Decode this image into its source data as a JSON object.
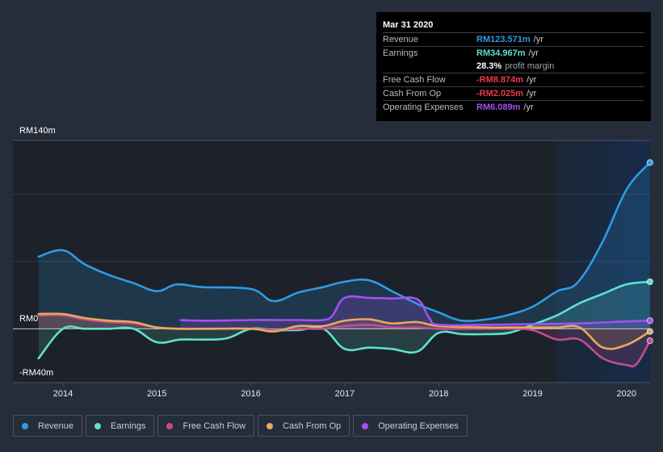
{
  "tooltip": {
    "date": "Mar 31 2020",
    "rows": [
      {
        "label": "Revenue",
        "value": "RM123.571m",
        "unit": "/yr",
        "color": "#2e9be6"
      },
      {
        "label": "Earnings",
        "value": "RM34.967m",
        "unit": "/yr",
        "color": "#5fe0cf"
      },
      {
        "label": "",
        "value": "28.3%",
        "unit": "profit margin",
        "color": "#ffffff"
      },
      {
        "label": "Free Cash Flow",
        "value": "-RM8.874m",
        "unit": "/yr",
        "color": "#ee3a46"
      },
      {
        "label": "Cash From Op",
        "value": "-RM2.025m",
        "unit": "/yr",
        "color": "#ee3a46"
      },
      {
        "label": "Operating Expenses",
        "value": "RM6.089m",
        "unit": "/yr",
        "color": "#a64ff2"
      }
    ]
  },
  "legend": [
    {
      "label": "Revenue",
      "color": "#2e9be6"
    },
    {
      "label": "Earnings",
      "color": "#5fe0cf"
    },
    {
      "label": "Free Cash Flow",
      "color": "#c44d8e"
    },
    {
      "label": "Cash From Op",
      "color": "#e8a95e"
    },
    {
      "label": "Operating Expenses",
      "color": "#a64ff2"
    }
  ],
  "chart_data": {
    "type": "area",
    "title": "",
    "xlabel": "",
    "ylabel": "",
    "ylim": [
      -40,
      140
    ],
    "xlim": [
      2013.74,
      2020.25
    ],
    "y_tick_labels": [
      "RM140m",
      "RM0",
      "-RM40m"
    ],
    "y_ticks": [
      140,
      0,
      -40
    ],
    "x_tick_labels": [
      "2014",
      "2015",
      "2016",
      "2017",
      "2018",
      "2019",
      "2020"
    ],
    "x_ticks": [
      2014,
      2015,
      2016,
      2017,
      2018,
      2019,
      2020
    ],
    "gridlines": [
      140,
      100,
      50,
      0
    ],
    "highlight_range": [
      2019.25,
      2020.25
    ],
    "legend_position": "bottom",
    "series": [
      {
        "name": "Revenue",
        "color": "#2e9be6",
        "x": [
          2013.74,
          2014.0,
          2014.23,
          2014.49,
          2014.75,
          2015.0,
          2015.21,
          2015.48,
          2016.0,
          2016.24,
          2016.51,
          2016.77,
          2017.0,
          2017.26,
          2017.54,
          2017.8,
          2018.0,
          2018.23,
          2018.49,
          2018.75,
          2019.0,
          2019.26,
          2019.48,
          2019.74,
          2020.0,
          2020.25
        ],
        "values": [
          53.6,
          58.4,
          48,
          40,
          34,
          28,
          33,
          31,
          29.6,
          20.6,
          27,
          31,
          35,
          36,
          26.6,
          17.6,
          12.2,
          6.2,
          6.8,
          10.4,
          16.4,
          27.8,
          34.4,
          64,
          103.4,
          123.571
        ]
      },
      {
        "name": "Earnings",
        "color": "#5fe0cf",
        "x": [
          2013.74,
          2014.0,
          2014.23,
          2014.49,
          2014.75,
          2015.0,
          2015.25,
          2015.5,
          2015.75,
          2016.0,
          2016.25,
          2016.5,
          2016.77,
          2017.0,
          2017.26,
          2017.5,
          2017.77,
          2018.0,
          2018.25,
          2018.5,
          2018.75,
          2019.0,
          2019.26,
          2019.5,
          2019.75,
          2020.0,
          2020.25
        ],
        "values": [
          -22,
          0,
          0,
          0,
          0,
          -10,
          -8,
          -8,
          -7,
          0,
          -1,
          -1,
          0,
          -15,
          -14,
          -15,
          -17,
          -3,
          -4,
          -4,
          -3,
          3,
          10,
          19,
          26,
          33,
          34.967
        ]
      },
      {
        "name": "Free Cash Flow",
        "color": "#c44d8e",
        "x": [
          2013.74,
          2014.0,
          2014.23,
          2014.49,
          2014.75,
          2015.0,
          2015.25,
          2015.5,
          2016.0,
          2016.25,
          2016.5,
          2016.77,
          2017.0,
          2017.26,
          2017.5,
          2017.77,
          2018.0,
          2018.5,
          2018.75,
          2019.0,
          2019.26,
          2019.5,
          2019.75,
          2020.0,
          2020.11,
          2020.25
        ],
        "values": [
          10,
          10,
          7,
          5,
          4,
          1,
          0,
          0,
          0,
          -1,
          0,
          0,
          2,
          3,
          1,
          1,
          0,
          0,
          0,
          -1,
          -8,
          -8,
          -22,
          -27,
          -26,
          -8.874
        ]
      },
      {
        "name": "Cash From Op",
        "color": "#e8a95e",
        "x": [
          2013.74,
          2014.0,
          2014.23,
          2014.49,
          2014.75,
          2015.0,
          2015.25,
          2015.5,
          2016.0,
          2016.25,
          2016.5,
          2016.77,
          2017.0,
          2017.26,
          2017.5,
          2017.77,
          2018.0,
          2018.5,
          2018.75,
          2019.0,
          2019.26,
          2019.5,
          2019.75,
          2020.0,
          2020.25
        ],
        "values": [
          11,
          11,
          8,
          6,
          5,
          1,
          0,
          0,
          0,
          -2,
          2,
          2,
          6,
          7,
          4,
          5,
          2,
          1,
          1,
          1,
          1,
          1,
          -14,
          -12,
          -2.025
        ]
      },
      {
        "name": "Operating Expenses",
        "color": "#a64ff2",
        "x": [
          2015.25,
          2015.5,
          2016.0,
          2016.25,
          2016.5,
          2016.77,
          2016.87,
          2017.0,
          2017.26,
          2017.5,
          2017.77,
          2017.9,
          2018.0,
          2018.5,
          2019.0,
          2019.5,
          2020.0,
          2020.25
        ],
        "values": [
          6.5,
          6,
          6.5,
          6.5,
          6.5,
          6.5,
          10,
          23,
          23,
          22.5,
          22,
          8,
          3,
          3,
          3.5,
          4,
          5.5,
          6.089
        ]
      }
    ]
  }
}
